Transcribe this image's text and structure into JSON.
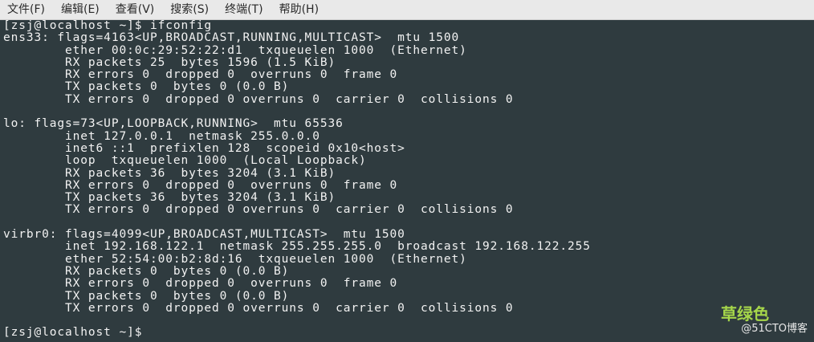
{
  "menu": {
    "file": "文件(F)",
    "edit": "编辑(E)",
    "view": "查看(V)",
    "search": "搜索(S)",
    "terminal": "终端(T)",
    "help": "帮助(H)"
  },
  "terminal": {
    "lines": [
      "[zsj@localhost ~]$ ifconfig",
      "ens33: flags=4163<UP,BROADCAST,RUNNING,MULTICAST>  mtu 1500",
      "        ether 00:0c:29:52:22:d1  txqueuelen 1000  (Ethernet)",
      "        RX packets 25  bytes 1596 (1.5 KiB)",
      "        RX errors 0  dropped 0  overruns 0  frame 0",
      "        TX packets 0  bytes 0 (0.0 B)",
      "        TX errors 0  dropped 0 overruns 0  carrier 0  collisions 0",
      "",
      "lo: flags=73<UP,LOOPBACK,RUNNING>  mtu 65536",
      "        inet 127.0.0.1  netmask 255.0.0.0",
      "        inet6 ::1  prefixlen 128  scopeid 0x10<host>",
      "        loop  txqueuelen 1000  (Local Loopback)",
      "        RX packets 36  bytes 3204 (3.1 KiB)",
      "        RX errors 0  dropped 0  overruns 0  frame 0",
      "        TX packets 36  bytes 3204 (3.1 KiB)",
      "        TX errors 0  dropped 0 overruns 0  carrier 0  collisions 0",
      "",
      "virbr0: flags=4099<UP,BROADCAST,MULTICAST>  mtu 1500",
      "        inet 192.168.122.1  netmask 255.255.255.0  broadcast 192.168.122.255",
      "        ether 52:54:00:b2:8d:16  txqueuelen 1000  (Ethernet)",
      "        RX packets 0  bytes 0 (0.0 B)",
      "        RX errors 0  dropped 0  overruns 0  frame 0",
      "        TX packets 0  bytes 0 (0.0 B)",
      "        TX errors 0  dropped 0 overruns 0  carrier 0  collisions 0",
      "",
      "[zsj@localhost ~]$"
    ]
  },
  "watermark": {
    "name": "草绿色",
    "site": "@51CTO博客"
  },
  "colors": {
    "terminal_bg": "#2f3b3f",
    "terminal_fg": "#f2f2f2",
    "menubar_bg": "#e9e9e9",
    "watermark_green": "#a6d64a"
  }
}
